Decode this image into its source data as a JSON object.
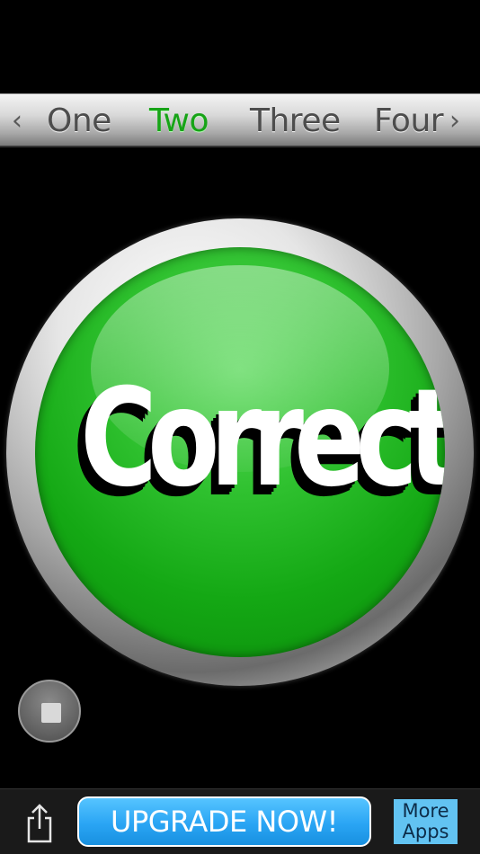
{
  "tabs": {
    "prev_symbol": "‹",
    "next_symbol": "›",
    "items": [
      {
        "label": "One",
        "active": false
      },
      {
        "label": "Two",
        "active": true
      },
      {
        "label": "Three",
        "active": false
      },
      {
        "label": "Four",
        "active": false
      }
    ],
    "active_color": "#17a317",
    "inactive_color": "#4d4d4d"
  },
  "main_button": {
    "label": "Correct!",
    "color": "#2fc12f"
  },
  "stop_button": {
    "icon": "stop-icon"
  },
  "bottom_bar": {
    "share_icon": "share-icon",
    "upgrade_label": "UPGRADE NOW!",
    "more_apps_line1": "More",
    "more_apps_line2": "Apps"
  }
}
